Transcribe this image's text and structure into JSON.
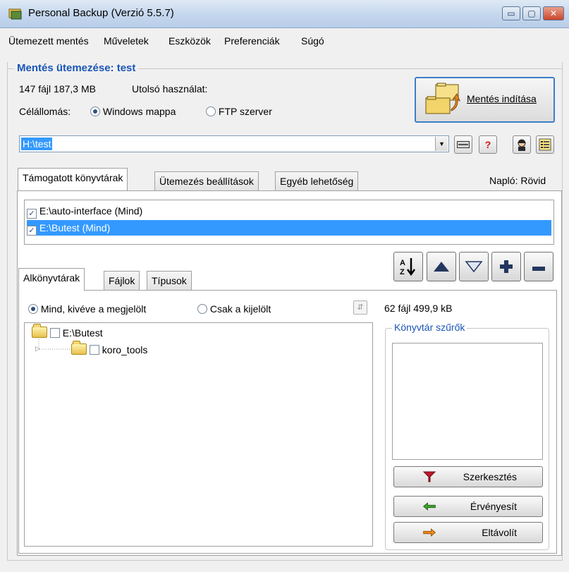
{
  "window": {
    "title": "Personal Backup (Verzió 5.5.7)",
    "min_glyph": "▭",
    "max_glyph": "▢",
    "close_glyph": "✕"
  },
  "menu": [
    "Ütemezett mentés",
    "Műveletek",
    "Eszközök",
    "Preferenciák",
    "Súgó"
  ],
  "schedule": {
    "legend": "Mentés ütemezése: test",
    "stats": "147 fájl 187,3 MB",
    "last_used_label": "Utolsó használat:",
    "destination_label": "Célállomás:",
    "dest_options": [
      {
        "label": "Windows mappa",
        "selected": true
      },
      {
        "label": "FTP szerver",
        "selected": false
      }
    ],
    "start_button": "Mentés indítása",
    "path": "H:\\test"
  },
  "toolbar_icons": [
    "combo-dropdown",
    "drive-icon",
    "help-icon",
    "user-icon",
    "settings-list-icon"
  ],
  "main_tabs": [
    "Támogatott könyvtárak",
    "Ütemezés beállítások",
    "Egyéb lehetőség"
  ],
  "log_level": "Napló: Rövid",
  "directories": [
    {
      "label": "E:\\auto-interface (Mind)",
      "checked": true,
      "selected": false
    },
    {
      "label": "E:\\Butest (Mind)",
      "checked": true,
      "selected": true
    }
  ],
  "sub_tabs": [
    "Alkönyvtárak",
    "Fájlok",
    "Típusok"
  ],
  "scope_options": [
    {
      "label": "Mind, kivéve a megjelölt",
      "selected": true
    },
    {
      "label": "Csak a kijelölt",
      "selected": false
    }
  ],
  "file_stats": "62 fájl 499,9 kB",
  "tree": [
    {
      "label": "E:\\Butest",
      "level": 0
    },
    {
      "label": "koro_tools",
      "level": 1
    }
  ],
  "filters": {
    "legend": "Könyvtár szűrők",
    "edit": "Szerkesztés",
    "apply": "Érvényesít",
    "remove": "Eltávolít"
  },
  "colors": {
    "accent": "#1a55b8",
    "selection": "#3399ff"
  }
}
